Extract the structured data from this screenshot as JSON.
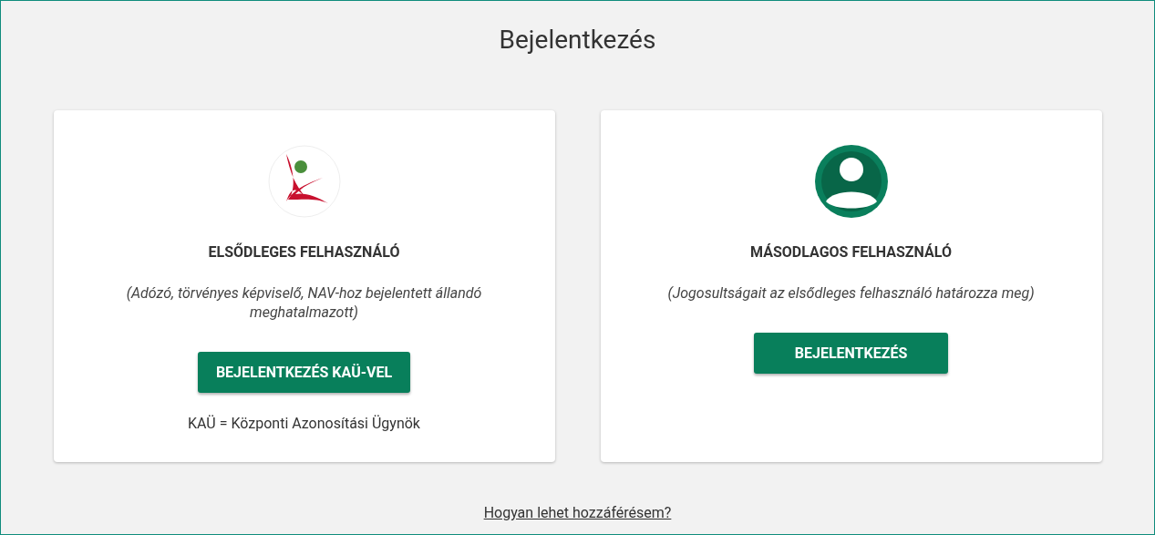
{
  "title": "Bejelentkezés",
  "cards": [
    {
      "kind": "kau",
      "heading": "ELSŐDLEGES FELHASZNÁLÓ",
      "description": "(Adózó, törvényes képviselő, NAV-hoz bejelentett állandó meghatalmazott)",
      "button": "BEJELENTKEZÉS KAÜ-VEL",
      "note": "KAÜ = Központi Azonosítási Ügynök"
    },
    {
      "kind": "user",
      "heading": "MÁSODLAGOS FELHASZNÁLÓ",
      "description": "(Jogosultságait az elsődleges felhasználó határozza meg)",
      "button": "BEJELENTKEZÉS"
    }
  ],
  "help_link": "Hogyan lehet hozzáférésem?"
}
